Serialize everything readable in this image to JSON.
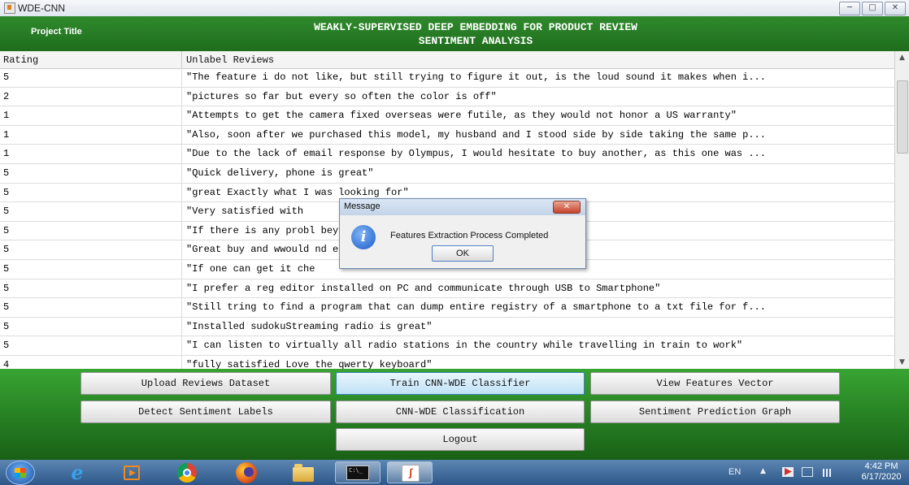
{
  "window": {
    "title": "WDE-CNN",
    "controls": [
      "minimize",
      "maximize",
      "close"
    ]
  },
  "header": {
    "project_label": "Project Title",
    "title_line1": "WEAKLY-SUPERVISED DEEP EMBEDDING FOR PRODUCT REVIEW",
    "title_line2": "SENTIMENT ANALYSIS"
  },
  "table": {
    "columns": [
      "Rating",
      "Unlabel Reviews"
    ],
    "rows": [
      {
        "rating": "5",
        "review": "\"The feature i do not like, but still trying to figure it out, is the loud sound it makes when i..."
      },
      {
        "rating": "2",
        "review": "\"pictures so far but every so often the color is off\""
      },
      {
        "rating": "1",
        "review": "\"Attempts to get the camera fixed overseas were futile, as they would not honor a US warranty\""
      },
      {
        "rating": "1",
        "review": "\"Also, soon after we purchased this model, my husband and I stood side by side taking the same p..."
      },
      {
        "rating": "1",
        "review": "\"Due to the lack of email response by Olympus, I would hesitate to buy another, as this one was ..."
      },
      {
        "rating": "5",
        "review": "\"Quick delivery, phone is great\""
      },
      {
        "rating": "5",
        "review": "\"great Exactly what I was looking for\""
      },
      {
        "rating": "5",
        "review": "\"Very satisfied with"
      },
      {
        "rating": "5",
        "review": "\"If there is any probl                                  beyond good customer service, they give ..."
      },
      {
        "rating": "5",
        "review": "\"Great buy and wwould                                    nd easy to maneuver without the instruct..."
      },
      {
        "rating": "5",
        "review": "\"If one can get it che"
      },
      {
        "rating": "5",
        "review": "\"I prefer a reg editor installed on PC and communicate through USB to Smartphone\""
      },
      {
        "rating": "5",
        "review": "\"Still tring to find a program that can dump entire registry of a smartphone to a txt file for f..."
      },
      {
        "rating": "5",
        "review": "\"Installed sudokuStreaming radio is great\""
      },
      {
        "rating": "5",
        "review": "\"I can listen to virtually all radio stations in the country while travelling in train to work\""
      },
      {
        "rating": "4",
        "review": "\"fully satisfied Love the qwerty keyboard\""
      }
    ]
  },
  "buttons": {
    "upload": "Upload Reviews Dataset",
    "train": "Train CNN-WDE Classifier",
    "view_features": "View Features Vector",
    "detect": "Detect Sentiment Labels",
    "classify": "CNN-WDE Classification",
    "graph": "Sentiment Prediction Graph",
    "logout": "Logout"
  },
  "dialog": {
    "title": "Message",
    "message": "Features Extraction Process Completed",
    "ok_label": "OK",
    "icon": "info-icon"
  },
  "taskbar": {
    "items": [
      "start-button",
      "internet-explorer",
      "media-player",
      "chrome",
      "firefox",
      "file-explorer",
      "command-prompt",
      "java-app"
    ],
    "language": "EN",
    "time": "4:42 PM",
    "date": "6/17/2020"
  },
  "colors": {
    "header_green": "#2f8a2c",
    "panel_green": "#37a532",
    "taskbar_blue": "#2c5788"
  }
}
